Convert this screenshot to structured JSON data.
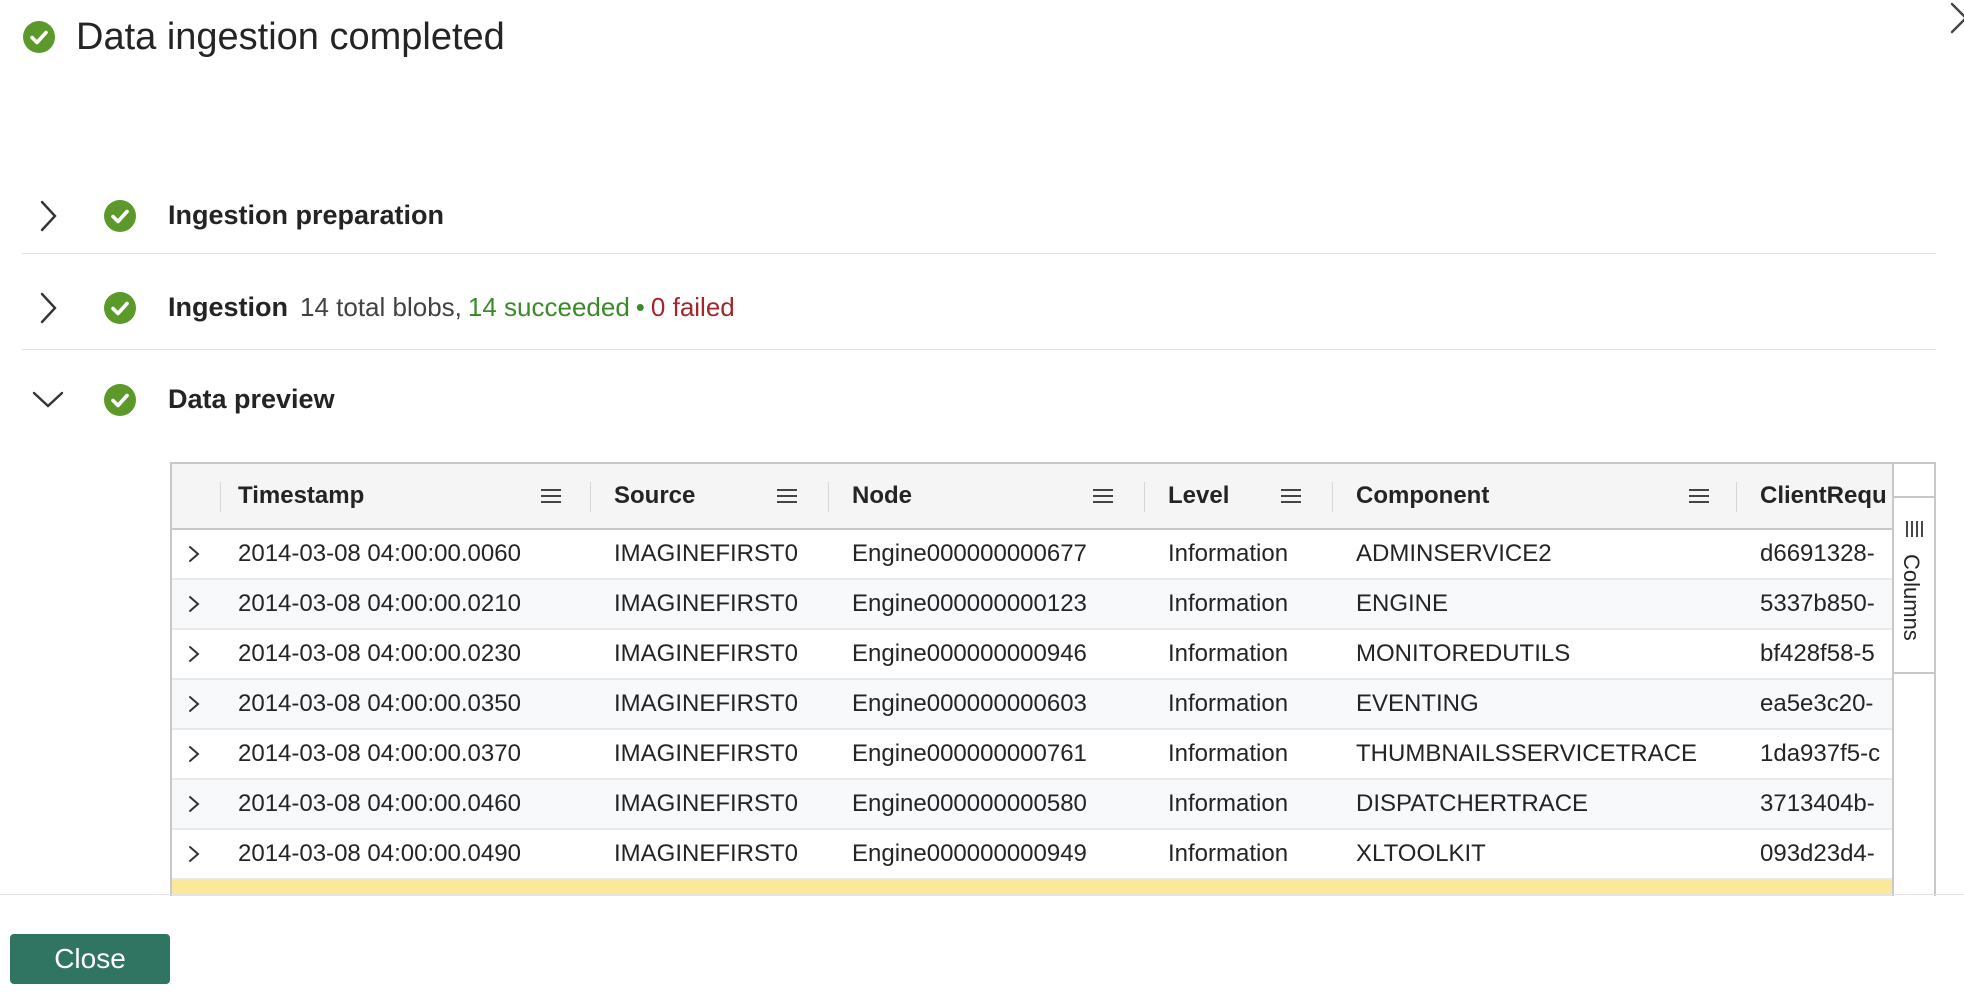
{
  "header": {
    "title": "Data ingestion completed"
  },
  "sections": {
    "preparation": {
      "label": "Ingestion preparation"
    },
    "ingestion": {
      "label": "Ingestion",
      "total_text": "14 total blobs,",
      "succeeded_text": "14 succeeded",
      "separator": "•",
      "failed_text": "0 failed"
    },
    "preview": {
      "label": "Data preview"
    }
  },
  "grid": {
    "columns": [
      "Timestamp",
      "Source",
      "Node",
      "Level",
      "Component",
      "ClientRequ"
    ],
    "rows": [
      [
        "2014-03-08 04:00:00.0060",
        "IMAGINEFIRST0",
        "Engine000000000677",
        "Information",
        "ADMINSERVICE2",
        "d6691328-"
      ],
      [
        "2014-03-08 04:00:00.0210",
        "IMAGINEFIRST0",
        "Engine000000000123",
        "Information",
        "ENGINE",
        "5337b850-"
      ],
      [
        "2014-03-08 04:00:00.0230",
        "IMAGINEFIRST0",
        "Engine000000000946",
        "Information",
        "MONITOREDUTILS",
        "bf428f58-5"
      ],
      [
        "2014-03-08 04:00:00.0350",
        "IMAGINEFIRST0",
        "Engine000000000603",
        "Information",
        "EVENTING",
        "ea5e3c20-"
      ],
      [
        "2014-03-08 04:00:00.0370",
        "IMAGINEFIRST0",
        "Engine000000000761",
        "Information",
        "THUMBNAILSSERVICETRACE",
        "1da937f5-c"
      ],
      [
        "2014-03-08 04:00:00.0460",
        "IMAGINEFIRST0",
        "Engine000000000580",
        "Information",
        "DISPATCHERTRACE",
        "3713404b-"
      ],
      [
        "2014-03-08 04:00:00.0490",
        "IMAGINEFIRST0",
        "Engine000000000949",
        "Information",
        "XLTOOLKIT",
        "093d23d4-"
      ]
    ],
    "side_panel_label": "Columns"
  },
  "footer": {
    "close_label": "Close"
  },
  "colors": {
    "success": "#5b9a2a",
    "succeeded_text": "#3a8a2a",
    "failed_text": "#a4262c",
    "primary_button": "#2f7562",
    "selected_row": "#fbe89a"
  }
}
